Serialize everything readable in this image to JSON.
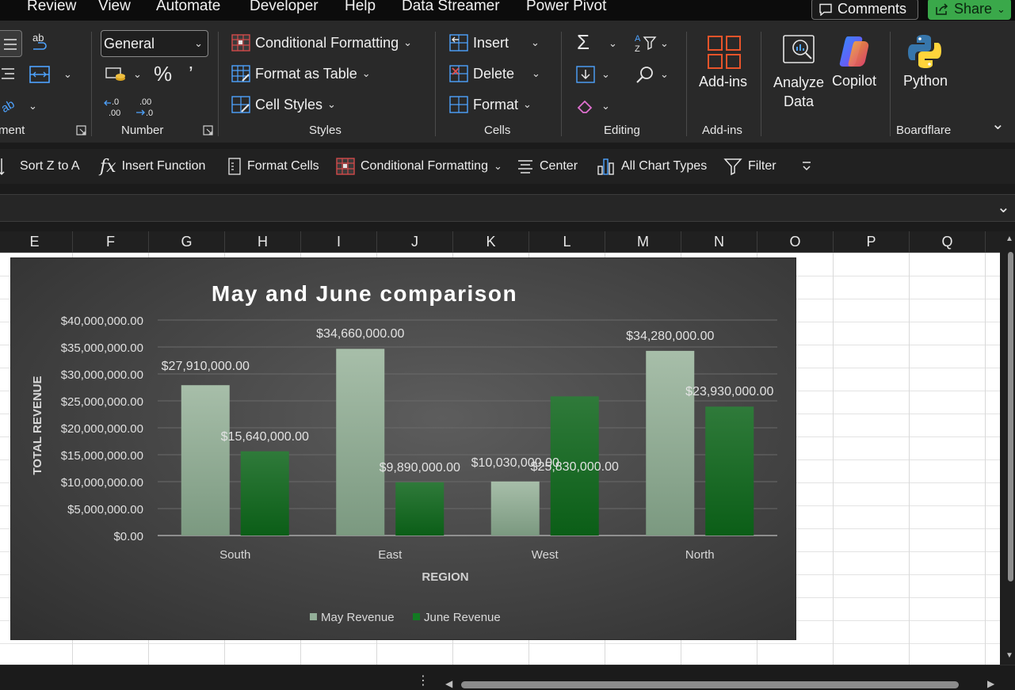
{
  "menu": {
    "tabs": [
      "Review",
      "View",
      "Automate",
      "Developer",
      "Help",
      "Data Streamer",
      "Power Pivot"
    ],
    "comments_label": "Comments",
    "share_label": "Share"
  },
  "ribbon": {
    "alignment_label": "ment",
    "number": {
      "format_value": "General",
      "group_label": "Number"
    },
    "styles": {
      "conditional_formatting": "Conditional Formatting",
      "format_as_table": "Format as Table",
      "cell_styles": "Cell Styles",
      "group_label": "Styles"
    },
    "cells": {
      "insert": "Insert",
      "delete": "Delete",
      "format": "Format",
      "group_label": "Cells"
    },
    "editing": {
      "group_label": "Editing"
    },
    "addins": {
      "button_label": "Add-ins",
      "group_label": "Add-ins"
    },
    "analyze_data": "Analyze Data",
    "copilot": "Copilot",
    "python": "Python",
    "boardflare_label": "Boardflare"
  },
  "qat": {
    "sort_z_to_a": "Sort Z to A",
    "insert_function": "Insert Function",
    "format_cells": "Format Cells",
    "conditional_formatting": "Conditional Formatting",
    "center": "Center",
    "all_chart_types": "All Chart Types",
    "filter": "Filter"
  },
  "columns": [
    "E",
    "F",
    "G",
    "H",
    "I",
    "J",
    "K",
    "L",
    "M",
    "N",
    "O",
    "P",
    "Q"
  ],
  "colors": {
    "may": "#93af98",
    "june": "#137a23",
    "share_green": "#3aa84a"
  },
  "chart_data": {
    "type": "bar",
    "title": "May and June comparison",
    "xlabel": "REGION",
    "ylabel": "TOTAL REVENUE",
    "categories": [
      "South",
      "East",
      "West",
      "North"
    ],
    "series": [
      {
        "name": "May Revenue",
        "values": [
          27910000,
          34660000,
          10030000,
          34280000
        ]
      },
      {
        "name": "June Revenue",
        "values": [
          15640000,
          9890000,
          25830000,
          23930000
        ]
      }
    ],
    "data_labels": [
      [
        "$27,910,000.00",
        "$34,660,000.00",
        "$10,030,000.00",
        "$34,280,000.00"
      ],
      [
        "$15,640,000.00",
        "$9,890,000.00",
        "$25,830,000.00",
        "$23,930,000.00"
      ]
    ],
    "yticks": [
      0,
      5000000,
      10000000,
      15000000,
      20000000,
      25000000,
      30000000,
      35000000,
      40000000
    ],
    "ytick_labels": [
      "$0.00",
      "$5,000,000.00",
      "$10,000,000.00",
      "$15,000,000.00",
      "$20,000,000.00",
      "$25,000,000.00",
      "$30,000,000.00",
      "$35,000,000.00",
      "$40,000,000.00"
    ],
    "ylim": [
      0,
      40000000
    ],
    "grid": true,
    "legend": "bottom"
  }
}
